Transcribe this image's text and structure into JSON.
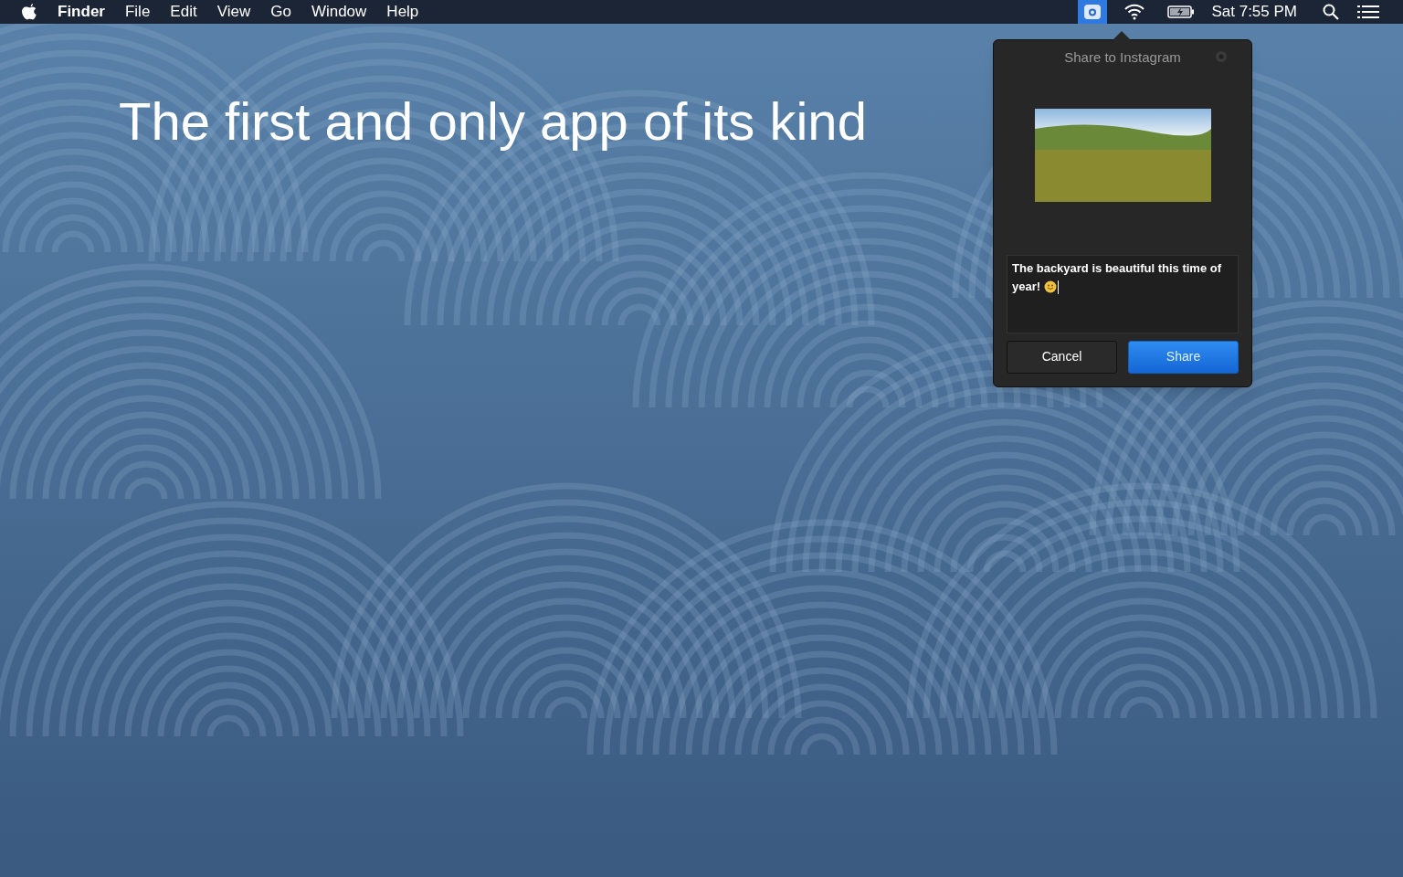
{
  "menu_bar": {
    "app_name": "Finder",
    "menus": [
      "File",
      "Edit",
      "View",
      "Go",
      "Window",
      "Help"
    ],
    "status_items": [
      {
        "kind": "camera",
        "selected": true
      },
      {
        "kind": "wifi",
        "selected": false
      },
      {
        "kind": "battery",
        "selected": false
      }
    ],
    "clock": "Sat 7:55 PM"
  },
  "headline": "The first and only app of its kind",
  "popover": {
    "title": "Share to Instagram",
    "caption": {
      "value": "The backyard is beautiful this time of year!",
      "emoji": true
    },
    "buttons": [
      {
        "label": "Cancel",
        "kind": "secondary"
      },
      {
        "label": "Share",
        "kind": "primary"
      }
    ]
  }
}
